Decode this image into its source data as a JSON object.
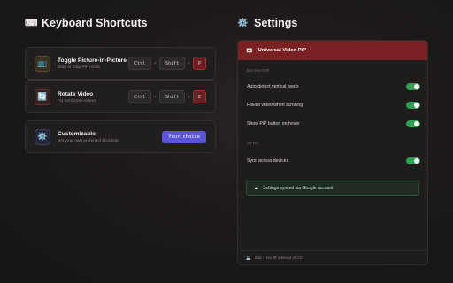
{
  "shortcuts": {
    "title": "Keyboard Shortcuts",
    "title_icon": "keyboard-icon",
    "items": [
      {
        "title": "Toggle Picture-in-Picture",
        "subtitle": "Start or stop PiP mode",
        "icon": "tv-icon",
        "keys": [
          "Ctrl",
          "Shift",
          "P"
        ]
      },
      {
        "title": "Rotate Video",
        "subtitle": "Fix horizontal videos",
        "icon": "rotate-icon",
        "keys": [
          "Ctrl",
          "Shift",
          "E"
        ]
      },
      {
        "title": "Customizable",
        "subtitle": "Set your own preferred shortcuts",
        "icon": "gear-icon",
        "button": "Your choice"
      }
    ]
  },
  "settings": {
    "title": "Settings",
    "title_icon": "gear-icon",
    "panel": {
      "header": "Universal Video PiP",
      "header_icon": "pip-window-icon",
      "behavior_label": "BEHAVIOR",
      "behavior": [
        {
          "label": "Auto-detect vertical feeds",
          "on": true
        },
        {
          "label": "Follow video when scrolling",
          "on": true
        },
        {
          "label": "Show PiP button on hover",
          "on": true
        }
      ],
      "sync_label": "SYNC",
      "sync": [
        {
          "label": "Sync across devices",
          "on": true
        }
      ],
      "sync_status": "Settings synced via Google account",
      "footer": "Mac: Use ⌘ instead of Ctrl"
    }
  },
  "colors": {
    "accent_red": "#7a2223",
    "toggle_on": "#2e9e54",
    "button_purple": "#5a54d6"
  }
}
